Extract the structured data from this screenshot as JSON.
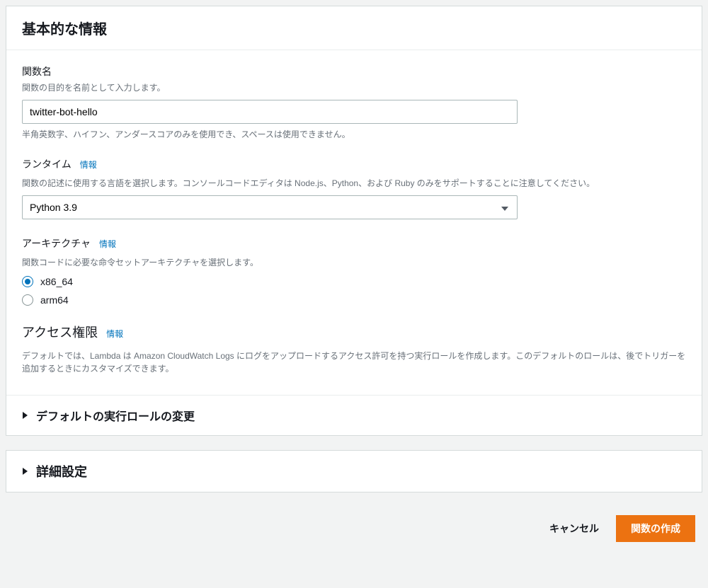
{
  "basic": {
    "title": "基本的な情報",
    "functionName": {
      "label": "関数名",
      "help": "関数の目的を名前として入力します。",
      "value": "twitter-bot-hello",
      "constraint": "半角英数字、ハイフン、アンダースコアのみを使用でき、スペースは使用できません。"
    },
    "runtime": {
      "label": "ランタイム",
      "infoLink": "情報",
      "help": "関数の記述に使用する言語を選択します。コンソールコードエディタは Node.js、Python、および Ruby のみをサポートすることに注意してください。",
      "selected": "Python 3.9"
    },
    "architecture": {
      "label": "アーキテクチャ",
      "infoLink": "情報",
      "help": "関数コードに必要な命令セットアーキテクチャを選択します。",
      "options": [
        {
          "value": "x86_64",
          "checked": true
        },
        {
          "value": "arm64",
          "checked": false
        }
      ]
    },
    "permissions": {
      "title": "アクセス権限",
      "infoLink": "情報",
      "help": "デフォルトでは、Lambda は Amazon CloudWatch Logs にログをアップロードするアクセス許可を持つ実行ロールを作成します。このデフォルトのロールは、後でトリガーを追加するときにカスタマイズできます。"
    },
    "changeRole": {
      "label": "デフォルトの実行ロールの変更"
    }
  },
  "advanced": {
    "title": "詳細設定"
  },
  "footer": {
    "cancel": "キャンセル",
    "create": "関数の作成"
  }
}
